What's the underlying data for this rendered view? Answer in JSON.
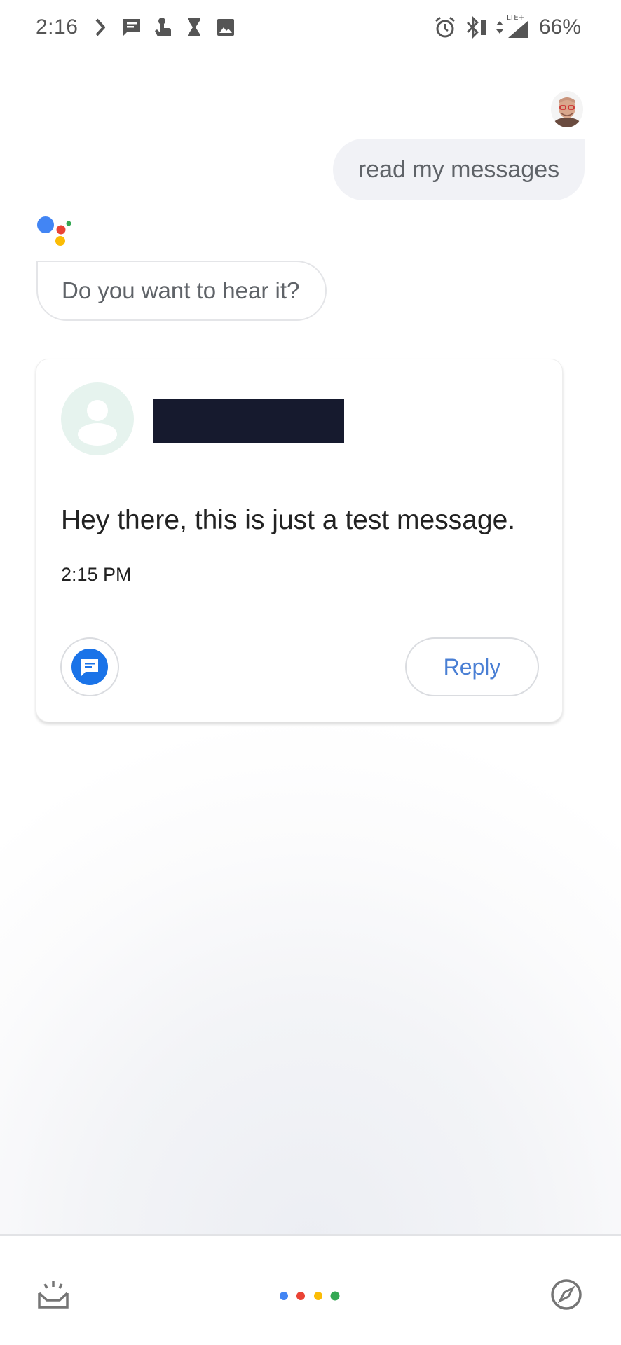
{
  "status_bar": {
    "time": "2:16",
    "battery": "66%",
    "left_icons": [
      "chevron-right-icon",
      "message-icon",
      "gesture-icon",
      "hourglass-icon",
      "image-icon"
    ],
    "right_icons": [
      "alarm-icon",
      "bluetooth-icon",
      "data-arrows-icon",
      "lte-signal-icon"
    ],
    "network_label": "LTE+"
  },
  "conversation": {
    "user_query": "read my messages",
    "assistant_reply": "Do you want to hear it?"
  },
  "message_card": {
    "sender_name_redacted": true,
    "message_body": "Hey there, this is just a test message.",
    "timestamp": "2:15 PM",
    "reply_label": "Reply"
  },
  "bottom_bar": {
    "left_icon": "snapshot-inbox-icon",
    "center": "assistant-dots",
    "right_icon": "explore-compass-icon"
  },
  "colors": {
    "google_blue": "#4285F4",
    "google_red": "#EA4335",
    "google_yellow": "#FBBC05",
    "google_green": "#34A853",
    "reply_text": "#4a7fd4",
    "messages_app_blue": "#1a73e8"
  }
}
